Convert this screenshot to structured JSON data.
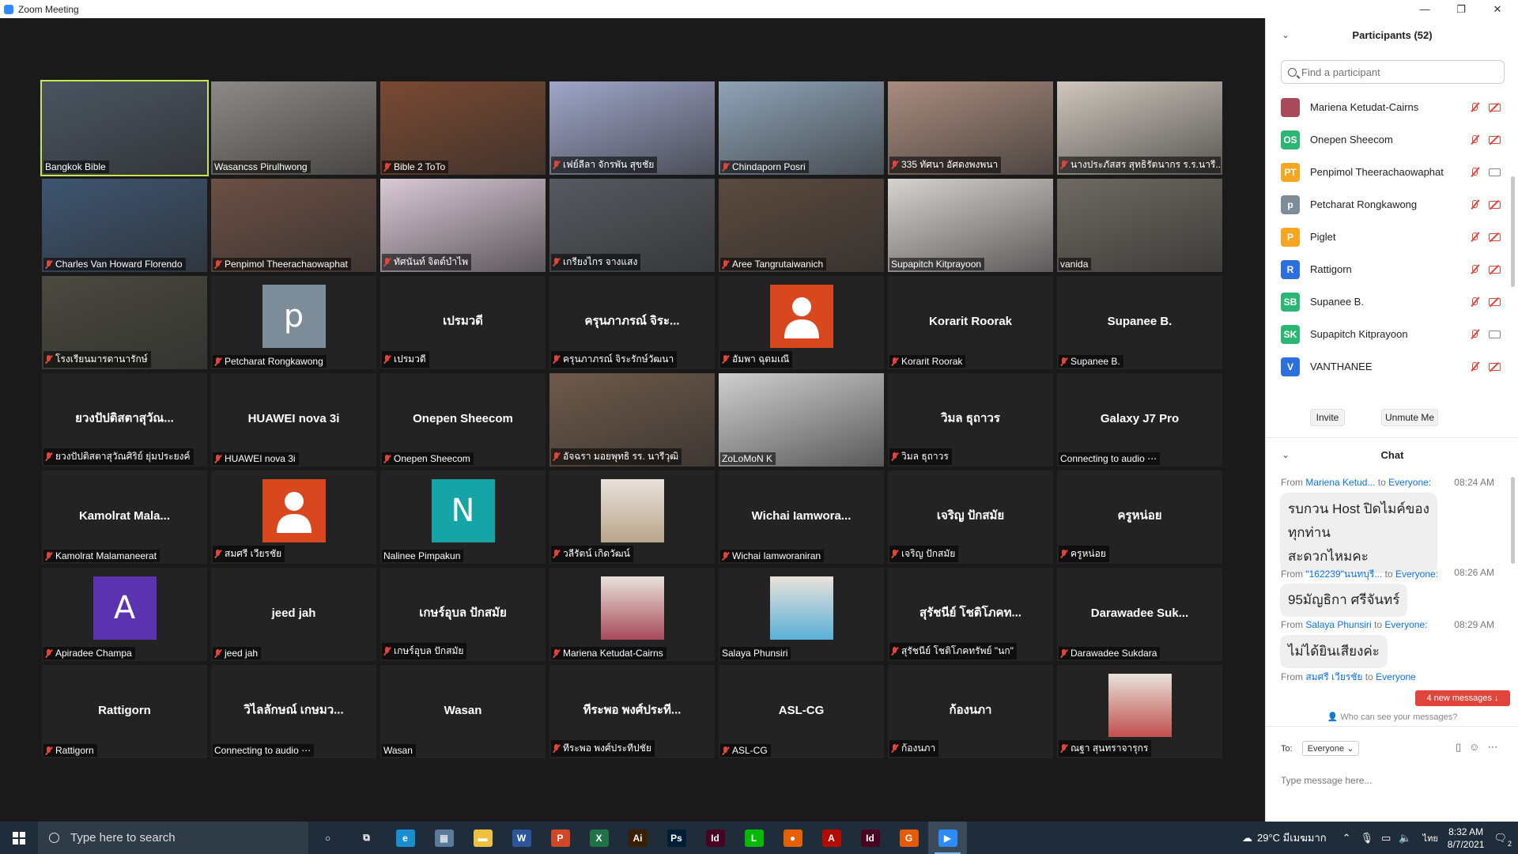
{
  "window": {
    "title": "Zoom Meeting"
  },
  "gallery": [
    {
      "type": "video",
      "name": "Bangkok Bible",
      "muted": false,
      "active": true,
      "bg": "#4a5560"
    },
    {
      "type": "video",
      "name": "Wasancss Pirulhwong",
      "muted": false,
      "bg": "#8d8a86"
    },
    {
      "type": "video",
      "name": "Bible 2 ToTo",
      "muted": true,
      "bg": "#7a4a32"
    },
    {
      "type": "video",
      "name": "เฟย์ลีลา จักรพัน สุขชัย",
      "muted": true,
      "bg": "#9fa6c8"
    },
    {
      "type": "video",
      "name": "Chindaporn Posri",
      "muted": true,
      "bg": "#8fa3b6"
    },
    {
      "type": "video",
      "name": "335 ทัศนา อัศดงพงพนา",
      "muted": true,
      "bg": "#a88c7e"
    },
    {
      "type": "video",
      "name": "นางประภัสสร สุทธิรัตนากร ร.ร.นารี...",
      "muted": true,
      "bg": "#cfc7bd"
    },
    {
      "type": "video",
      "name": "Charles Van Howard Florendo",
      "muted": true,
      "bg": "#3e5570"
    },
    {
      "type": "video",
      "name": "Penpimol Theerachaowaphat",
      "muted": true,
      "bg": "#6b5045"
    },
    {
      "type": "video",
      "name": "ทัศนันท์ จิตต์บำไพ",
      "muted": true,
      "bg": "#d9c9d6"
    },
    {
      "type": "video",
      "name": "เกรียงไกร จางแสง",
      "muted": true,
      "bg": "#565a60"
    },
    {
      "type": "video",
      "name": "Aree Tangrutaiwanich",
      "muted": true,
      "bg": "#5a4a3e"
    },
    {
      "type": "video",
      "name": "Supapitch Kitprayoon",
      "muted": false,
      "bg": "#d8d2d2"
    },
    {
      "type": "video",
      "name": "vanida",
      "muted": false,
      "bg": "#6e6a62"
    },
    {
      "type": "video",
      "name": "โรงเรียนมารดานารักษ์",
      "muted": true,
      "bg": "#4a4a40"
    },
    {
      "type": "avatar",
      "name": "Petcharat Rongkawong",
      "muted": true,
      "letter": "p",
      "color": "#7c8c99"
    },
    {
      "type": "text",
      "name": "เปรมวดี",
      "center": "เปรมวดี",
      "muted": true
    },
    {
      "type": "text",
      "name": "ครุนภาภรณ์ จิระรักษ์วัฒนา",
      "center": "ครุนภาภรณ์ จิระ...",
      "muted": true
    },
    {
      "type": "avatar",
      "name": "อัมพา ฉุดมเณี",
      "muted": true,
      "letter": "person",
      "color": "#d9471f"
    },
    {
      "type": "text",
      "name": "Korarit Roorak",
      "center": "Korarit Roorak",
      "muted": true
    },
    {
      "type": "text",
      "name": "Supanee B.",
      "center": "Supanee B.",
      "muted": true
    },
    {
      "type": "text",
      "name": "ยวงปัปติสตาสุวัณศิริย์ ยุ่มประยงค์",
      "center": "ยวงปัปติสตาสุวัณ...",
      "muted": true
    },
    {
      "type": "text",
      "name": "HUAWEI nova 3i",
      "center": "HUAWEI nova 3i",
      "muted": true
    },
    {
      "type": "text",
      "name": "Onepen Sheecom",
      "center": "Onepen Sheecom",
      "muted": true
    },
    {
      "type": "video",
      "name": "อัจฉรา มอยพุทธิ รร. นารีวุฒิ",
      "muted": true,
      "bg": "#6e5a4a"
    },
    {
      "type": "video",
      "name": "ZoLoMoN K",
      "muted": false,
      "bg": "#cfcfcf"
    },
    {
      "type": "text",
      "name": "วิมล ธุถาวร",
      "center": "วิมล ธุถาวร",
      "muted": true
    },
    {
      "type": "text",
      "name": "Connecting to audio ⋯",
      "center": "Galaxy J7 Pro",
      "muted": false
    },
    {
      "type": "text",
      "name": "Kamolrat Malamaneerat",
      "center": "Kamolrat Mala...",
      "muted": true
    },
    {
      "type": "avatar",
      "name": "สมศรี เวียรชัย",
      "muted": true,
      "letter": "person",
      "color": "#d9471f"
    },
    {
      "type": "avatar",
      "name": "Nalinee Pimpakun",
      "muted": false,
      "letter": "N",
      "color": "#14a4a6"
    },
    {
      "type": "photo",
      "name": "วลีรัตน์ เกิดวัฒน์",
      "muted": true,
      "color": "#b9a68b"
    },
    {
      "type": "text",
      "name": "Wichai Iamworaniran",
      "center": "Wichai Iamwora...",
      "muted": true
    },
    {
      "type": "text",
      "name": "เจริญ ปักสมัย",
      "center": "เจริญ ปักสมัย",
      "muted": true
    },
    {
      "type": "text",
      "name": "ครูหน่อย",
      "center": "ครูหน่อย",
      "muted": true
    },
    {
      "type": "avatar",
      "name": "Apiradee Champa",
      "muted": true,
      "letter": "A",
      "color": "#5b32b0"
    },
    {
      "type": "text",
      "name": "jeed jah",
      "center": "jeed jah",
      "muted": true
    },
    {
      "type": "text",
      "name": "เกษร์อุบล ปักสมัย",
      "center": "เกษร์อุบล ปักสมัย",
      "muted": true
    },
    {
      "type": "photo",
      "name": "Mariena Ketudat-Cairns",
      "muted": true,
      "color": "#a84a5a"
    },
    {
      "type": "photo",
      "name": "Salaya Phunsiri",
      "muted": false,
      "color": "#5ab0d8"
    },
    {
      "type": "text",
      "name": "สุรัชนีย์ โชติโภคทรัพย์ \"นก\"",
      "center": "สุรัชนีย์ โชติโภคท...",
      "muted": true
    },
    {
      "type": "text",
      "name": "Darawadee Sukdara",
      "center": "Darawadee Suk...",
      "muted": true
    },
    {
      "type": "text",
      "name": "Rattigorn",
      "center": "Rattigorn",
      "muted": true
    },
    {
      "type": "text",
      "name": "Connecting to audio ⋯",
      "center": "วิไลลักษณ์ เกษมว...",
      "muted": false
    },
    {
      "type": "text",
      "name": "Wasan",
      "center": "Wasan",
      "muted": false
    },
    {
      "type": "text",
      "name": "ทีระพอ พงศ์ประทีปชัย",
      "center": "ทีระพอ พงศ์ประที...",
      "muted": true
    },
    {
      "type": "text",
      "name": "ASL-CG",
      "center": "ASL-CG",
      "muted": true
    },
    {
      "type": "text",
      "name": "ก้องนภา",
      "center": "ก้องนภา",
      "muted": true
    },
    {
      "type": "photo",
      "name": "ณฐา สุนทราจารุกร",
      "muted": true,
      "color": "#c0504d"
    }
  ],
  "participants": {
    "title": "Participants (52)",
    "search_placeholder": "Find a participant",
    "list": [
      {
        "initials": "",
        "name": "Mariena Ketudat-Cairns",
        "color": "#a84a5a",
        "cam": "off"
      },
      {
        "initials": "OS",
        "name": "Onepen Sheecom",
        "color": "#2bb673",
        "cam": "off"
      },
      {
        "initials": "PT",
        "name": "Penpimol Theerachaowaphat",
        "color": "#f5a623",
        "cam": "on"
      },
      {
        "initials": "p",
        "name": "Petcharat Rongkawong",
        "color": "#7c8c99",
        "cam": "off"
      },
      {
        "initials": "P",
        "name": "Piglet",
        "color": "#f5a623",
        "cam": "off"
      },
      {
        "initials": "R",
        "name": "Rattigorn",
        "color": "#2d6fdc",
        "cam": "off"
      },
      {
        "initials": "SB",
        "name": "Supanee B.",
        "color": "#2bb673",
        "cam": "off"
      },
      {
        "initials": "SK",
        "name": "Supapitch Kitprayoon",
        "color": "#2bb673",
        "cam": "on"
      },
      {
        "initials": "V",
        "name": "VANTHANEE",
        "color": "#2d6fdc",
        "cam": "off"
      }
    ],
    "invite_label": "Invite",
    "unmute_label": "Unmute Me"
  },
  "chat": {
    "title": "Chat",
    "messages": [
      {
        "from": "Mariena Ketud...",
        "to": "Everyone:",
        "time": "08:24 AM",
        "text_lines": [
          "รบกวน Host ปิดไมค์ของ",
          "ทุกท่าน",
          "สะดวกไหมคะ"
        ]
      },
      {
        "from": "\"162239\"นนทบุรี...",
        "to": "Everyone:",
        "time": "08:26 AM",
        "text_lines": [
          "95มัญธิกา ศรีจันทร์"
        ]
      },
      {
        "from": "Salaya Phunsiri",
        "to": "Everyone:",
        "time": "08:29 AM",
        "text_lines": [
          "ไม่ได้ยินเสียงค่ะ"
        ]
      },
      {
        "from": "สมศรี เวียรชัย",
        "to": "Everyone",
        "time": "",
        "text_lines": []
      }
    ],
    "new_messages": "4 new messages ↓",
    "who_can_see": "Who can see your messages?",
    "to_label": "To:",
    "to_value": "Everyone ⌄",
    "input_placeholder": "Type message here..."
  },
  "taskbar": {
    "search_placeholder": "Type here to search",
    "apps": [
      {
        "name": "cortana",
        "glyph": "○",
        "color": "transparent"
      },
      {
        "name": "task-view",
        "glyph": "⧉",
        "color": "transparent"
      },
      {
        "name": "edge",
        "glyph": "e",
        "color": "#1a8fd0"
      },
      {
        "name": "calculator",
        "glyph": "▦",
        "color": "#5a7a9a"
      },
      {
        "name": "file-explorer",
        "glyph": "▬",
        "color": "#f0c040"
      },
      {
        "name": "word",
        "glyph": "W",
        "color": "#2b579a"
      },
      {
        "name": "powerpoint",
        "glyph": "P",
        "color": "#d24726"
      },
      {
        "name": "excel",
        "glyph": "X",
        "color": "#217346"
      },
      {
        "name": "illustrator",
        "glyph": "Ai",
        "color": "#3a1f00"
      },
      {
        "name": "photoshop",
        "glyph": "Ps",
        "color": "#001e36"
      },
      {
        "name": "indesign",
        "glyph": "Id",
        "color": "#49021f"
      },
      {
        "name": "line",
        "glyph": "L",
        "color": "#00b900"
      },
      {
        "name": "firefox",
        "glyph": "●",
        "color": "#e66000"
      },
      {
        "name": "acrobat",
        "glyph": "A",
        "color": "#b30b00"
      },
      {
        "name": "indesign-2",
        "glyph": "Id",
        "color": "#49021f"
      },
      {
        "name": "g-app",
        "glyph": "G",
        "color": "#e65a00"
      },
      {
        "name": "zoom",
        "glyph": "▶",
        "color": "#2d8cff"
      }
    ],
    "weather": "29°C มีเมฆมาก",
    "lang": "ไทย",
    "time": "8:32 AM",
    "date": "8/7/2021",
    "notifications": "2"
  }
}
